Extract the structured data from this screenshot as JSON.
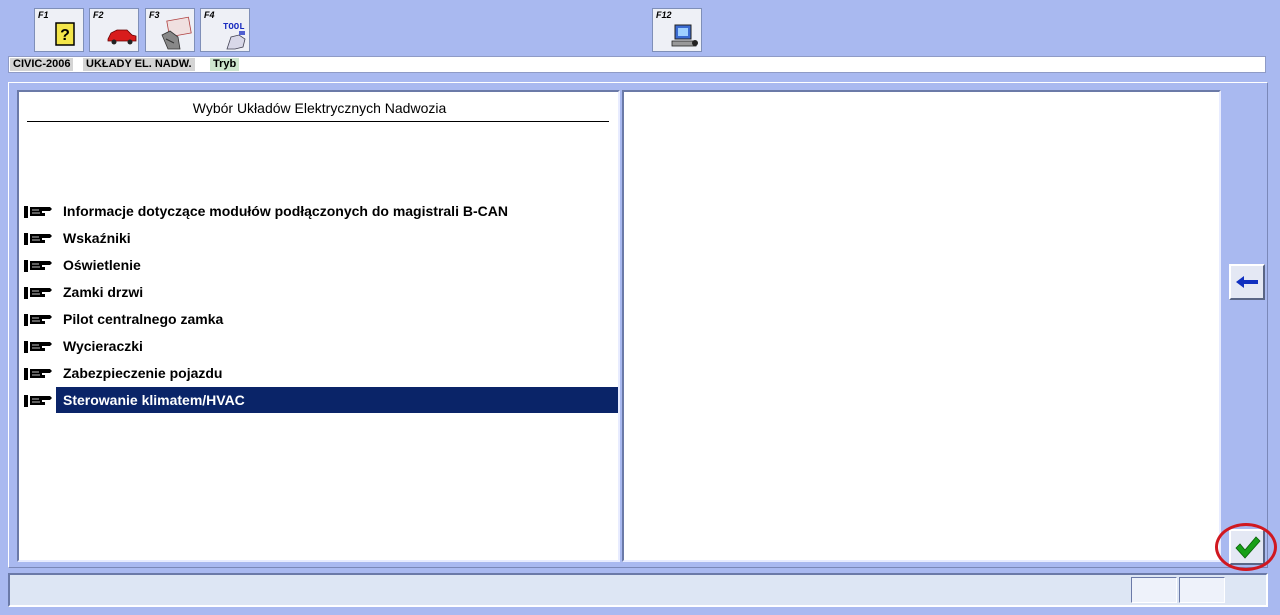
{
  "toolbar": {
    "keys": [
      {
        "label": "F1",
        "icon": "help-icon"
      },
      {
        "label": "F2",
        "icon": "car-icon"
      },
      {
        "label": "F3",
        "icon": "data-hand-icon"
      },
      {
        "label": "F4",
        "icon": "tool-icon",
        "icon_text": "TOOL"
      },
      {
        "label": "F12",
        "icon": "computer-icon"
      }
    ]
  },
  "breadcrumb": {
    "vehicle": "CIVIC-2006",
    "section": "UKŁADY EL. NADW.",
    "mode": "Tryb"
  },
  "left_panel": {
    "title": "Wybór Układów Elektrycznych Nadwozia",
    "items": [
      {
        "label": "Informacje dotyczące modułów podłączonych do magistrali B-CAN",
        "selected": false
      },
      {
        "label": "Wskaźniki",
        "selected": false
      },
      {
        "label": "Oświetlenie",
        "selected": false
      },
      {
        "label": "Zamki drzwi",
        "selected": false
      },
      {
        "label": "Pilot centralnego zamka",
        "selected": false
      },
      {
        "label": "Wycieraczki",
        "selected": false
      },
      {
        "label": "Zabezpieczenie pojazdu",
        "selected": false
      },
      {
        "label": "Sterowanie klimatem/HVAC",
        "selected": true
      }
    ]
  },
  "side_buttons": {
    "back_icon": "arrow-left-icon",
    "ok_icon": "checkmark-icon"
  },
  "colors": {
    "background": "#a9b9f0",
    "selection": "#0a2468",
    "highlight_ring": "#d01820",
    "check": "#18a018",
    "arrow": "#1030c0"
  }
}
